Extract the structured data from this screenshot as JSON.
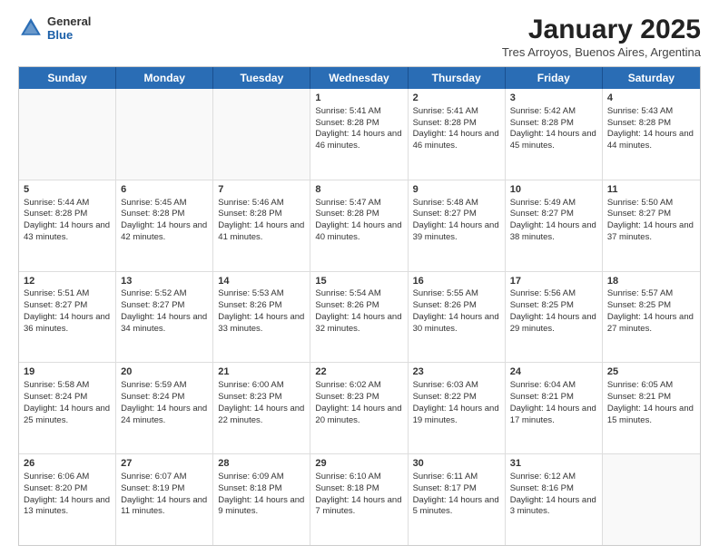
{
  "header": {
    "title": "January 2025",
    "subtitle": "Tres Arroyos, Buenos Aires, Argentina",
    "logo_general": "General",
    "logo_blue": "Blue"
  },
  "calendar": {
    "days_of_week": [
      "Sunday",
      "Monday",
      "Tuesday",
      "Wednesday",
      "Thursday",
      "Friday",
      "Saturday"
    ],
    "rows": [
      [
        {
          "day": "",
          "info": ""
        },
        {
          "day": "",
          "info": ""
        },
        {
          "day": "",
          "info": ""
        },
        {
          "day": "1",
          "info": "Sunrise: 5:41 AM\nSunset: 8:28 PM\nDaylight: 14 hours and 46 minutes."
        },
        {
          "day": "2",
          "info": "Sunrise: 5:41 AM\nSunset: 8:28 PM\nDaylight: 14 hours and 46 minutes."
        },
        {
          "day": "3",
          "info": "Sunrise: 5:42 AM\nSunset: 8:28 PM\nDaylight: 14 hours and 45 minutes."
        },
        {
          "day": "4",
          "info": "Sunrise: 5:43 AM\nSunset: 8:28 PM\nDaylight: 14 hours and 44 minutes."
        }
      ],
      [
        {
          "day": "5",
          "info": "Sunrise: 5:44 AM\nSunset: 8:28 PM\nDaylight: 14 hours and 43 minutes."
        },
        {
          "day": "6",
          "info": "Sunrise: 5:45 AM\nSunset: 8:28 PM\nDaylight: 14 hours and 42 minutes."
        },
        {
          "day": "7",
          "info": "Sunrise: 5:46 AM\nSunset: 8:28 PM\nDaylight: 14 hours and 41 minutes."
        },
        {
          "day": "8",
          "info": "Sunrise: 5:47 AM\nSunset: 8:28 PM\nDaylight: 14 hours and 40 minutes."
        },
        {
          "day": "9",
          "info": "Sunrise: 5:48 AM\nSunset: 8:27 PM\nDaylight: 14 hours and 39 minutes."
        },
        {
          "day": "10",
          "info": "Sunrise: 5:49 AM\nSunset: 8:27 PM\nDaylight: 14 hours and 38 minutes."
        },
        {
          "day": "11",
          "info": "Sunrise: 5:50 AM\nSunset: 8:27 PM\nDaylight: 14 hours and 37 minutes."
        }
      ],
      [
        {
          "day": "12",
          "info": "Sunrise: 5:51 AM\nSunset: 8:27 PM\nDaylight: 14 hours and 36 minutes."
        },
        {
          "day": "13",
          "info": "Sunrise: 5:52 AM\nSunset: 8:27 PM\nDaylight: 14 hours and 34 minutes."
        },
        {
          "day": "14",
          "info": "Sunrise: 5:53 AM\nSunset: 8:26 PM\nDaylight: 14 hours and 33 minutes."
        },
        {
          "day": "15",
          "info": "Sunrise: 5:54 AM\nSunset: 8:26 PM\nDaylight: 14 hours and 32 minutes."
        },
        {
          "day": "16",
          "info": "Sunrise: 5:55 AM\nSunset: 8:26 PM\nDaylight: 14 hours and 30 minutes."
        },
        {
          "day": "17",
          "info": "Sunrise: 5:56 AM\nSunset: 8:25 PM\nDaylight: 14 hours and 29 minutes."
        },
        {
          "day": "18",
          "info": "Sunrise: 5:57 AM\nSunset: 8:25 PM\nDaylight: 14 hours and 27 minutes."
        }
      ],
      [
        {
          "day": "19",
          "info": "Sunrise: 5:58 AM\nSunset: 8:24 PM\nDaylight: 14 hours and 25 minutes."
        },
        {
          "day": "20",
          "info": "Sunrise: 5:59 AM\nSunset: 8:24 PM\nDaylight: 14 hours and 24 minutes."
        },
        {
          "day": "21",
          "info": "Sunrise: 6:00 AM\nSunset: 8:23 PM\nDaylight: 14 hours and 22 minutes."
        },
        {
          "day": "22",
          "info": "Sunrise: 6:02 AM\nSunset: 8:23 PM\nDaylight: 14 hours and 20 minutes."
        },
        {
          "day": "23",
          "info": "Sunrise: 6:03 AM\nSunset: 8:22 PM\nDaylight: 14 hours and 19 minutes."
        },
        {
          "day": "24",
          "info": "Sunrise: 6:04 AM\nSunset: 8:21 PM\nDaylight: 14 hours and 17 minutes."
        },
        {
          "day": "25",
          "info": "Sunrise: 6:05 AM\nSunset: 8:21 PM\nDaylight: 14 hours and 15 minutes."
        }
      ],
      [
        {
          "day": "26",
          "info": "Sunrise: 6:06 AM\nSunset: 8:20 PM\nDaylight: 14 hours and 13 minutes."
        },
        {
          "day": "27",
          "info": "Sunrise: 6:07 AM\nSunset: 8:19 PM\nDaylight: 14 hours and 11 minutes."
        },
        {
          "day": "28",
          "info": "Sunrise: 6:09 AM\nSunset: 8:18 PM\nDaylight: 14 hours and 9 minutes."
        },
        {
          "day": "29",
          "info": "Sunrise: 6:10 AM\nSunset: 8:18 PM\nDaylight: 14 hours and 7 minutes."
        },
        {
          "day": "30",
          "info": "Sunrise: 6:11 AM\nSunset: 8:17 PM\nDaylight: 14 hours and 5 minutes."
        },
        {
          "day": "31",
          "info": "Sunrise: 6:12 AM\nSunset: 8:16 PM\nDaylight: 14 hours and 3 minutes."
        },
        {
          "day": "",
          "info": ""
        }
      ]
    ]
  }
}
